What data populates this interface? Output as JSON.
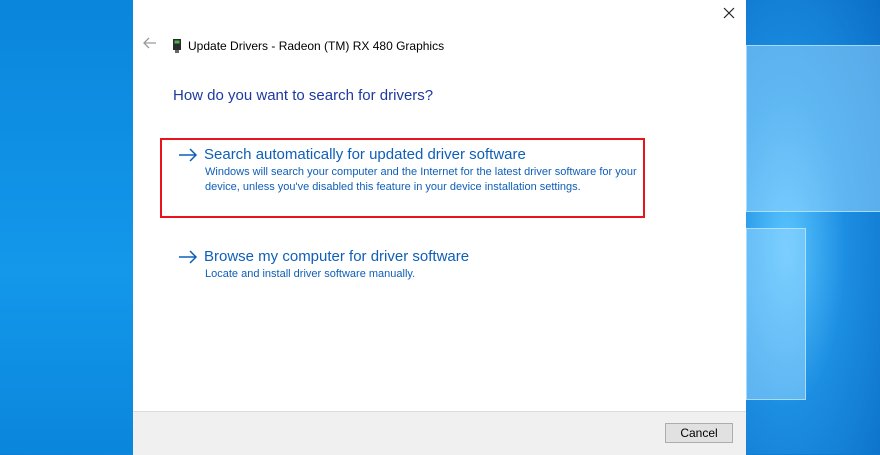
{
  "window": {
    "title": "Update Drivers - Radeon (TM) RX 480 Graphics",
    "close_icon": "close-icon",
    "back_icon": "back-arrow-icon",
    "device_icon": "display-adapter-icon"
  },
  "main": {
    "heading": "How do you want to search for drivers?",
    "options": [
      {
        "title": "Search automatically for updated driver software",
        "description": "Windows will search your computer and the Internet for the latest driver software for your device, unless you've disabled this feature in your device installation settings.",
        "icon": "arrow-right-icon",
        "highlighted": true
      },
      {
        "title": "Browse my computer for driver software",
        "description": "Locate and install driver software manually.",
        "icon": "arrow-right-icon",
        "highlighted": false
      }
    ]
  },
  "footer": {
    "cancel_label": "Cancel"
  },
  "colors": {
    "link": "#0f5fb8",
    "heading": "#1e3aa0",
    "highlight_border": "#e8141b"
  }
}
